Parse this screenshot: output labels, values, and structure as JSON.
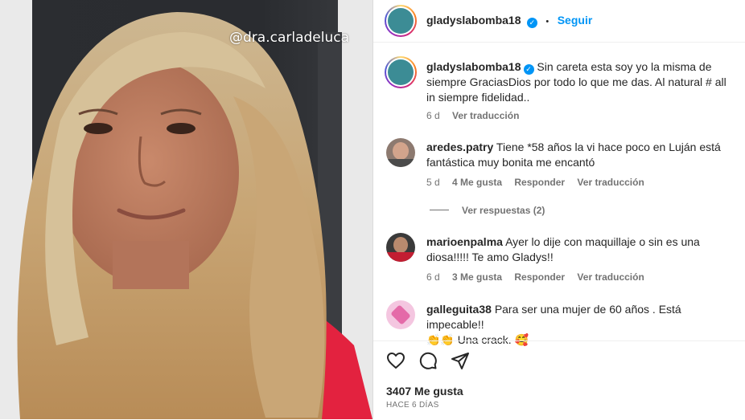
{
  "media": {
    "tag": "@dra.carladeluca"
  },
  "header": {
    "username": "gladyslabomba18",
    "separator": "•",
    "follow_label": "Seguir",
    "verified_glyph": "✓"
  },
  "caption": {
    "username": "gladyslabomba18",
    "text": "Sin careta esta soy yo la misma de siempre GraciasDios por todo lo que me das. Al natural # all in siempre fidelidad..",
    "age": "6 d",
    "translate": "Ver traducción"
  },
  "comments": [
    {
      "username": "aredes.patry",
      "text": "Tiene *58 años la vi hace poco en Luján está fantástica muy bonita me encantó",
      "age": "5 d",
      "likes": "4 Me gusta",
      "reply": "Responder",
      "translate": "Ver traducción",
      "replies": "Ver respuestas (2)"
    },
    {
      "username": "marioenpalma",
      "text": "Ayer lo dije con maquillaje o sin es una diosa!!!!! Te amo Gladys!!",
      "age": "6 d",
      "likes": "3 Me gusta",
      "reply": "Responder",
      "translate": "Ver traducción"
    },
    {
      "username": "galleguita38",
      "text": "Para ser una mujer de 60 años . Está impecable!!",
      "text2": "👏👏 Una crack. 🥰"
    }
  ],
  "footer": {
    "likes": "3407 Me gusta",
    "date": "HACE 6 DÍAS"
  },
  "colors": {
    "accent": "#0095f6",
    "muted": "#737373",
    "sweater": "#e3223f"
  },
  "icons": [
    "heart-icon",
    "comment-icon",
    "share-icon",
    "verified-icon"
  ]
}
